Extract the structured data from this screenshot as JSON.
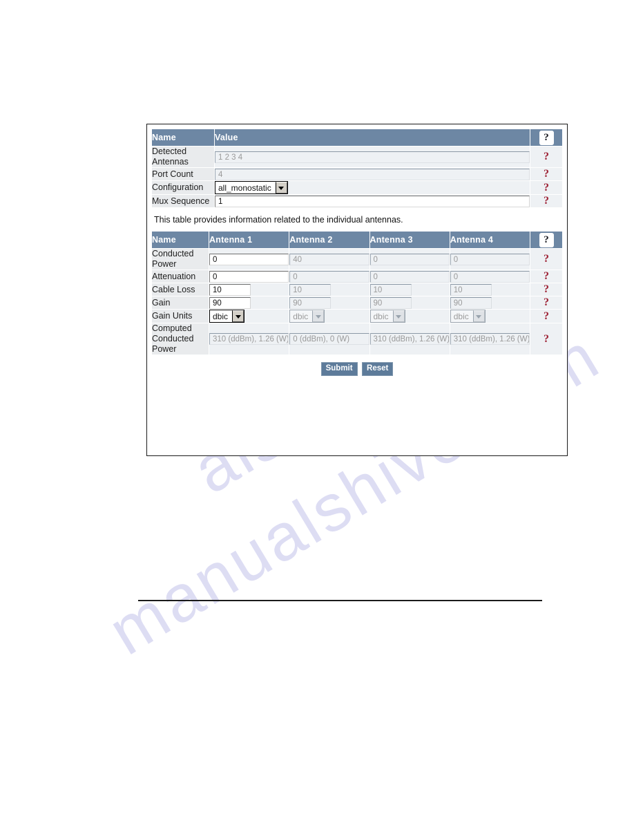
{
  "watermark": {
    "line1": "manualshive.com",
    "line2": "e.com",
    "line3": "alshiv"
  },
  "panel": {
    "summary_table": {
      "headers": {
        "name": "Name",
        "value": "Value",
        "help": "?"
      },
      "rows": [
        {
          "name": "Detected Antennas",
          "value": "1 2 3 4",
          "control": "text",
          "enabled": false,
          "help": "?"
        },
        {
          "name": "Port Count",
          "value": "4",
          "control": "text",
          "enabled": false,
          "help": "?"
        },
        {
          "name": "Configuration",
          "value": "all_monostatic",
          "control": "select",
          "enabled": true,
          "help": "?"
        },
        {
          "name": "Mux Sequence",
          "value": "1",
          "control": "text",
          "enabled": true,
          "help": "?"
        }
      ]
    },
    "description": "This table provides information related to the individual antennas.",
    "antenna_table": {
      "headers": {
        "name": "Name",
        "a1": "Antenna 1",
        "a2": "Antenna 2",
        "a3": "Antenna 3",
        "a4": "Antenna 4",
        "help": "?"
      },
      "rows": [
        {
          "name": "Conducted Power",
          "control": "text",
          "values": [
            "0",
            "40",
            "0",
            "0"
          ],
          "help": "?"
        },
        {
          "name": "Attenuation",
          "control": "text",
          "values": [
            "0",
            "0",
            "0",
            "0"
          ],
          "help": "?"
        },
        {
          "name": "Cable Loss",
          "control": "text",
          "short": true,
          "values": [
            "10",
            "10",
            "10",
            "10"
          ],
          "help": "?"
        },
        {
          "name": "Gain",
          "control": "text",
          "short": true,
          "values": [
            "90",
            "90",
            "90",
            "90"
          ],
          "help": "?"
        },
        {
          "name": "Gain Units",
          "control": "select",
          "values": [
            "dbic",
            "dbic",
            "dbic",
            "dbic"
          ],
          "help": "?"
        },
        {
          "name": "Computed Conducted Power",
          "control": "text",
          "readonly": true,
          "values": [
            "310 (ddBm), 1.26 (W)",
            "0 (ddBm), 0 (W)",
            "310 (ddBm), 1.26 (W)",
            "310 (ddBm), 1.26 (W)"
          ],
          "help": "?"
        }
      ]
    },
    "buttons": {
      "submit": "Submit",
      "reset": "Reset"
    }
  },
  "colors": {
    "header_blue": "#6d87a4",
    "name_cell": "#e9ebed",
    "value_cell": "#eef1f4",
    "help_red": "#9d2235",
    "button_blue": "#5d7b9a"
  }
}
